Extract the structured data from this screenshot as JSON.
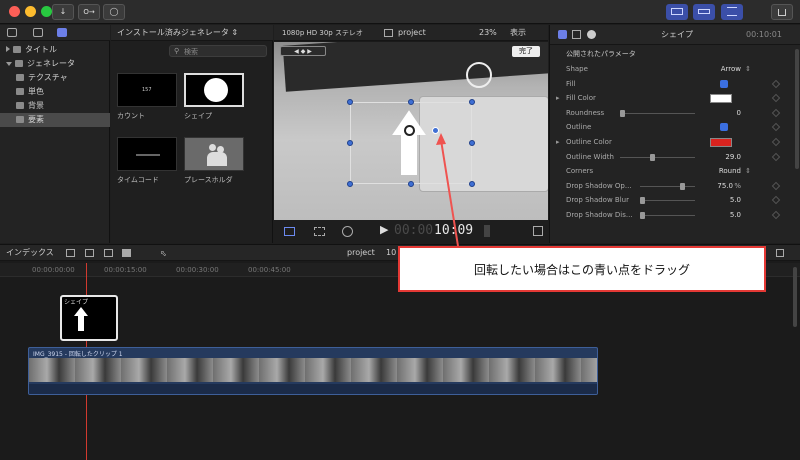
{
  "colors": {
    "accent": "#3b6fe0",
    "callout_border": "#e53935",
    "arrow": "#ef5350",
    "outline_swatch": "#d9231f",
    "fill_swatch": "#ffffff"
  },
  "toolbar": {
    "key_label": "O→"
  },
  "library": {
    "items": [
      {
        "label": "タイトル",
        "expanded": false
      },
      {
        "label": "ジェネレータ",
        "expanded": true
      },
      {
        "label": "テクスチャ"
      },
      {
        "label": "単色"
      },
      {
        "label": "背景"
      },
      {
        "label": "要素"
      }
    ]
  },
  "browser": {
    "header": "インストール済みジェネレータ",
    "search_placeholder": "検索",
    "thumbnails": [
      {
        "label": "カウント",
        "overlay": "157"
      },
      {
        "label": "シェイプ"
      },
      {
        "label": "タイムコード"
      },
      {
        "label": "プレースホルダ"
      }
    ]
  },
  "viewer": {
    "format": "1080p HD 30p ステレオ",
    "project": "project",
    "zoom": "23%",
    "view_menu": "表示",
    "done_button": "完了",
    "timecode_prefix": "00:00",
    "timecode": "10:09"
  },
  "inspector": {
    "title": "シェイプ",
    "timecode": "00:10:01",
    "section": "公開されたパラメータ",
    "rows": [
      {
        "label": "Shape",
        "value": "Arrow"
      },
      {
        "label": "Fill",
        "value": ""
      },
      {
        "label": "Fill Color",
        "value": ""
      },
      {
        "label": "Roundness",
        "value": "0"
      },
      {
        "label": "Outline",
        "value": ""
      },
      {
        "label": "Outline Color",
        "value": ""
      },
      {
        "label": "Outline Width",
        "value": "29.0"
      },
      {
        "label": "Corners",
        "value": "Round"
      },
      {
        "label": "Drop Shadow Op...",
        "value": "75.0"
      },
      {
        "label": "Drop Shadow Blur",
        "value": "5.0"
      },
      {
        "label": "Drop Shadow Dis...",
        "value": "5.0"
      }
    ],
    "percent_unit": "%"
  },
  "timeline": {
    "index_label": "インデックス",
    "project": "project",
    "project_time": "10",
    "ruler": [
      "00:00:00:00",
      "00:00:15:00",
      "00:00:30:00",
      "00:00:45:00"
    ],
    "shape_clip": "シェイプ",
    "video_clip": "IMG_3915 - 回転したクリップ 1"
  },
  "callout": {
    "text": "回転したい場合はこの青い点をドラッグ"
  }
}
